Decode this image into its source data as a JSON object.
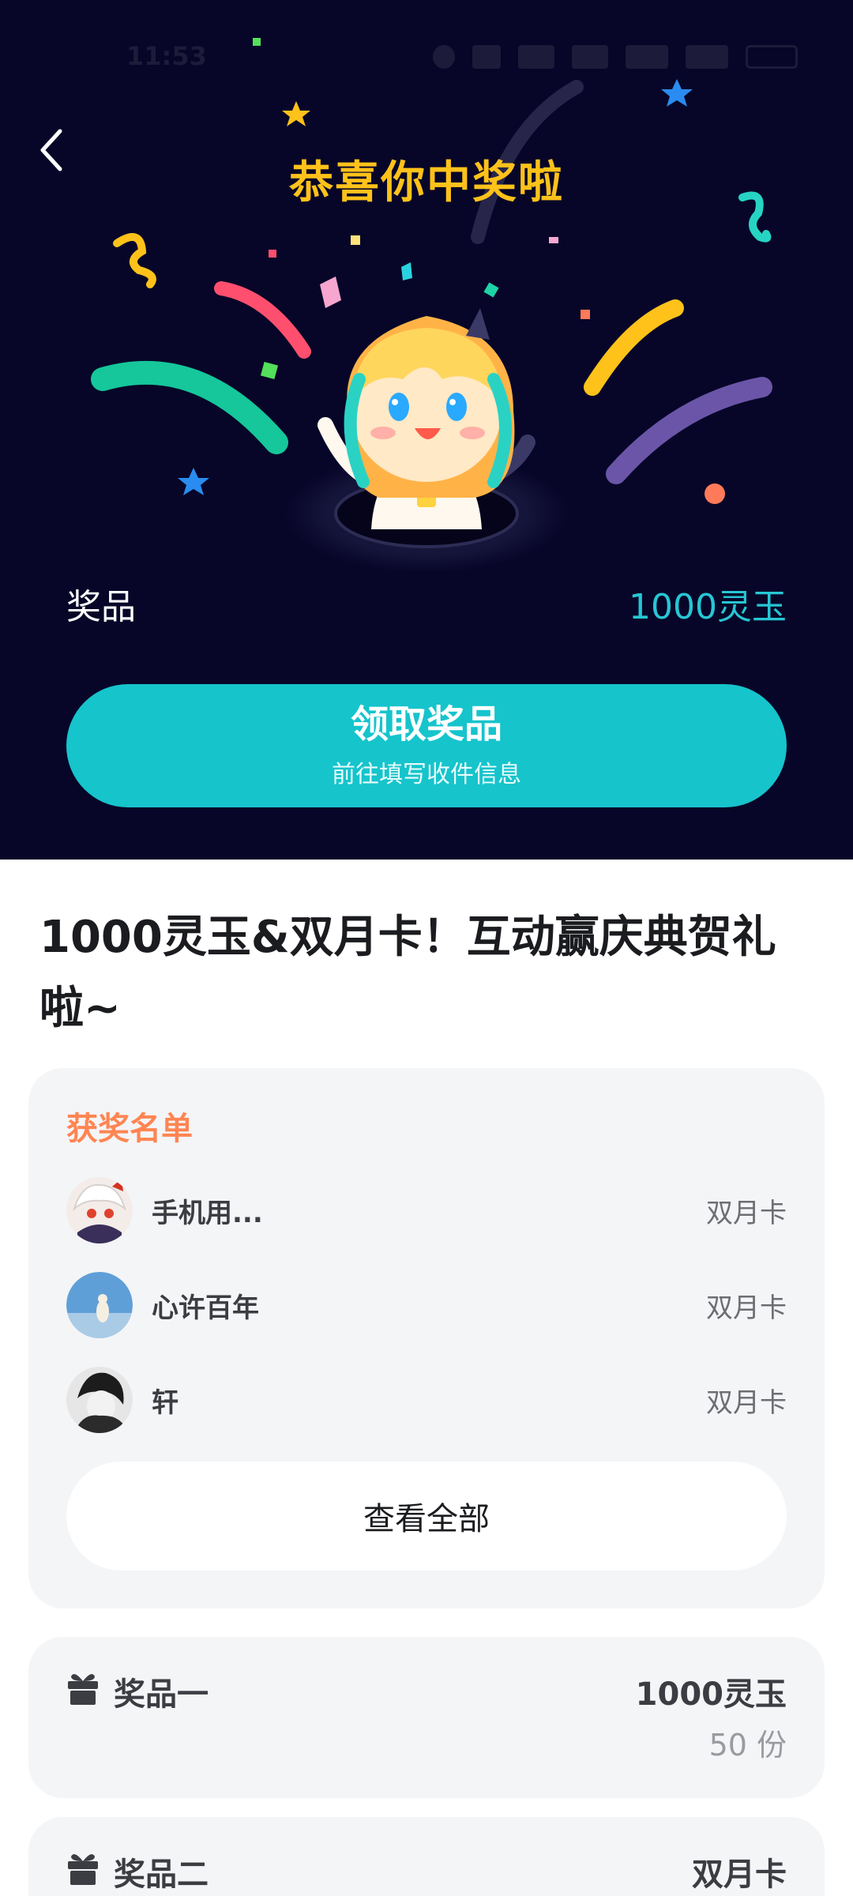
{
  "status_bar": {
    "time": "11:53"
  },
  "hero": {
    "title": "恭喜你中奖啦",
    "prize_label": "奖品",
    "prize_value": "1000灵玉",
    "claim_button": {
      "label": "领取奖品",
      "sublabel": "前往填写收件信息"
    }
  },
  "event": {
    "title": "1000灵玉&双月卡！互动赢庆典贺礼啦~"
  },
  "winners": {
    "heading": "获奖名单",
    "list": [
      {
        "name": "手机用...",
        "prize": "双月卡"
      },
      {
        "name": "心许百年",
        "prize": "双月卡"
      },
      {
        "name": "轩",
        "prize": "双月卡"
      }
    ],
    "view_all_label": "查看全部"
  },
  "prizes": [
    {
      "name": "奖品一",
      "value": "1000灵玉",
      "count": "50 份"
    },
    {
      "name": "奖品二",
      "value": "双月卡"
    }
  ],
  "colors": {
    "hero_bg": "#070628",
    "title_gold": "#ffc21a",
    "accent_teal": "#16c4cc",
    "winners_orange": "#ff8552",
    "card_bg": "#f4f5f7"
  },
  "icons": [
    "back-arrow-icon",
    "gift-icon"
  ]
}
